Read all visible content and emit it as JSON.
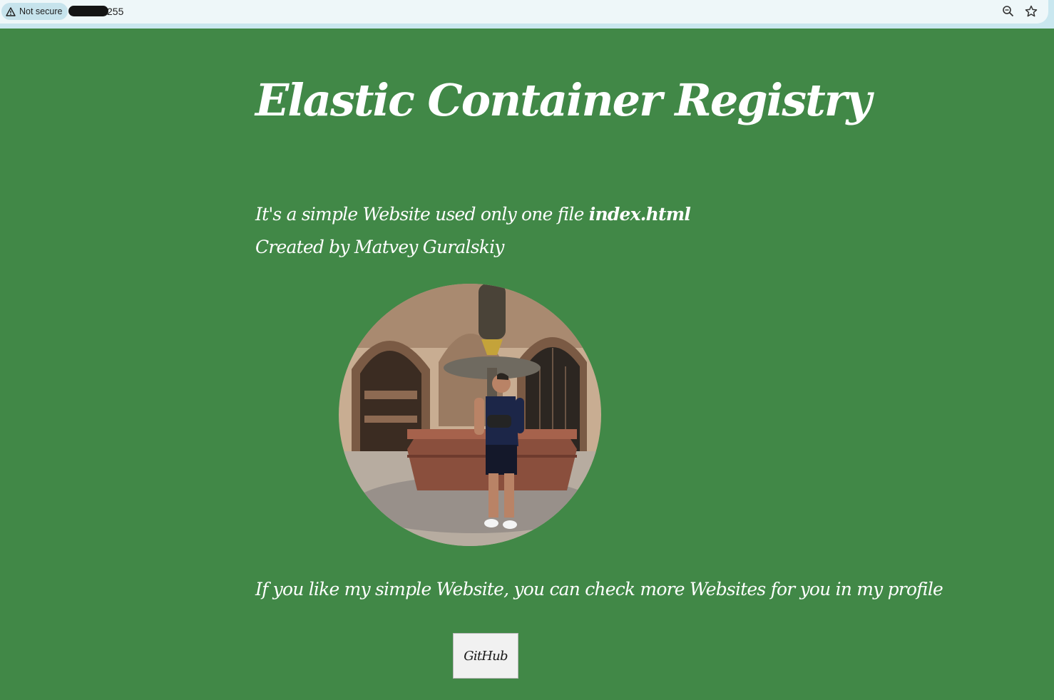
{
  "browser": {
    "security_label": "Not secure",
    "url_suffix": "255",
    "icons": [
      "warning-icon",
      "zoom-icon",
      "bookmark-star-icon"
    ]
  },
  "page": {
    "background_color": "#418847",
    "text_color": "#ffffff",
    "title": "Elastic Container Registry",
    "intro_line1_prefix": "It's a simple Website used only one file ",
    "intro_line1_filename": "index.html",
    "intro_line2": "Created by Matvey Guralskiy",
    "cta_text": "If you like my simple Website, you can check more Websites for you in my profile",
    "github_button_label": "GitHub"
  }
}
